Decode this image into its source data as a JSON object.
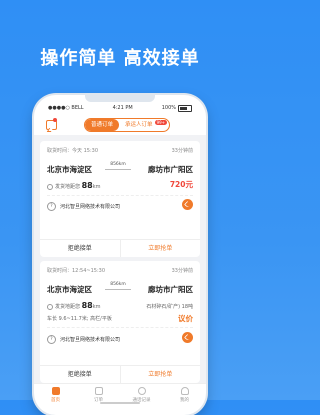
{
  "headline": "操作简单  高效接单",
  "status_bar": {
    "carrier": "●●●●○ BELL",
    "time": "4:21 PM",
    "battery": "100%"
  },
  "tabs": {
    "active": "普通订单",
    "inactive": "承运人订单",
    "badge": "99+"
  },
  "orders": [
    {
      "time": "取货时间：今天 15:30",
      "ago": "33分钟前",
      "from": "北京市海淀区",
      "to": "廊坊市广阳区",
      "distance": "856km",
      "dispatch_label": "发货地距您",
      "dispatch_value": "88",
      "dispatch_unit": "km",
      "price": "720元",
      "company": "河北智旦网络技术有限公司",
      "reject": "拒绝接单",
      "grab": "立即抢单"
    },
    {
      "time": "取货时间：12:54~15:30",
      "ago": "33分钟前",
      "from": "北京市海淀区",
      "to": "廊坊市广阳区",
      "distance": "856km",
      "dispatch_label": "发货地距您",
      "dispatch_value": "88",
      "dispatch_unit": "km",
      "cargo": "石材碎石/矿产) 18吨",
      "vehicle": "车长 9.6~11.7米; 高栏/平板",
      "price": "议价",
      "company": "河北智旦网络技术有限公司",
      "reject": "拒绝接单",
      "grab": "立即抢单"
    }
  ],
  "tabbar": [
    {
      "label": "首页",
      "icon": "home-icon"
    },
    {
      "label": "订单",
      "icon": "orders-icon"
    },
    {
      "label": "通话记录",
      "icon": "call-log-icon"
    },
    {
      "label": "我的",
      "icon": "profile-icon"
    }
  ],
  "colors": {
    "accent": "#f07a2a",
    "background": "#2f8ff5",
    "price": "#f0473a"
  }
}
